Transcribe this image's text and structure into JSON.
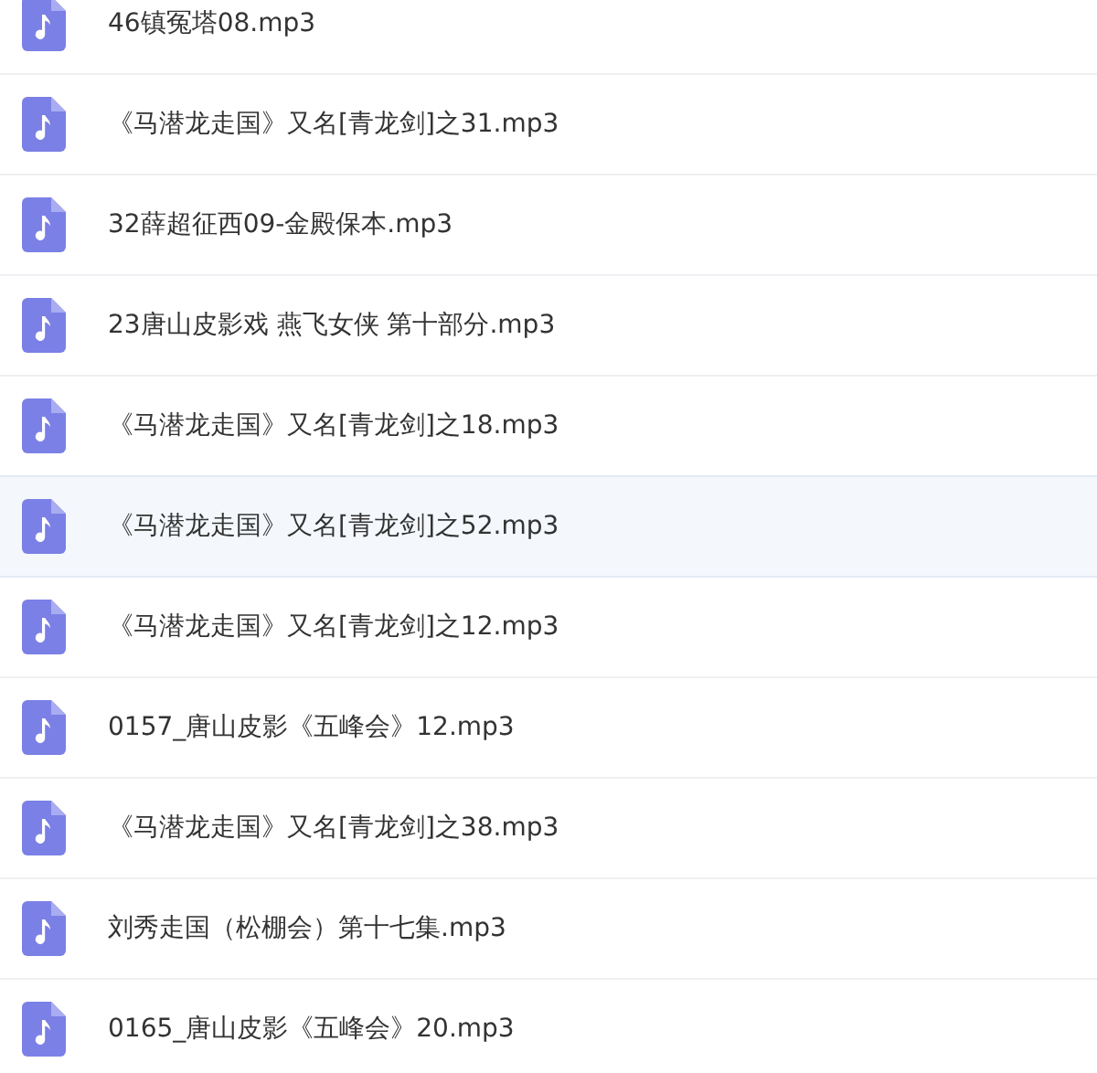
{
  "files": [
    {
      "name": "46镇冤塔08.mp3",
      "selected": false
    },
    {
      "name": "《马潜龙走国》又名[青龙剑]之31.mp3",
      "selected": false
    },
    {
      "name": "32薛超征西09-金殿保本.mp3",
      "selected": false
    },
    {
      "name": "23唐山皮影戏 燕飞女侠 第十部分.mp3",
      "selected": false
    },
    {
      "name": "《马潜龙走国》又名[青龙剑]之18.mp3",
      "selected": false
    },
    {
      "name": "《马潜龙走国》又名[青龙剑]之52.mp3",
      "selected": true
    },
    {
      "name": "《马潜龙走国》又名[青龙剑]之12.mp3",
      "selected": false
    },
    {
      "name": "0157_唐山皮影《五峰会》12.mp3",
      "selected": false
    },
    {
      "name": "《马潜龙走国》又名[青龙剑]之38.mp3",
      "selected": false
    },
    {
      "name": "刘秀走国（松棚会）第十七集.mp3",
      "selected": false
    },
    {
      "name": "0165_唐山皮影《五峰会》20.mp3",
      "selected": false
    }
  ]
}
